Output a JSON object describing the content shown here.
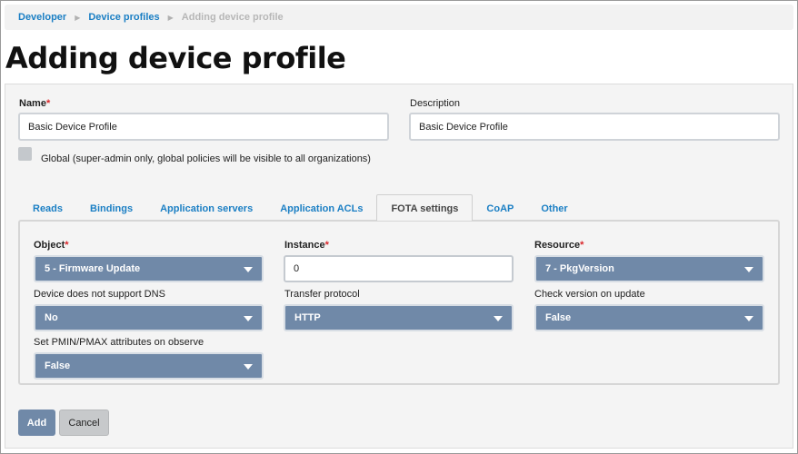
{
  "breadcrumb": {
    "items": [
      "Developer",
      "Device profiles"
    ],
    "current": "Adding device profile"
  },
  "page_title": "Adding device profile",
  "form": {
    "name_label": "Name",
    "name_required": "*",
    "name_value": "Basic Device Profile",
    "description_label": "Description",
    "description_value": "Basic Device Profile",
    "global_label": "Global (super-admin only, global policies will be visible to all organizations)",
    "global_checked": false
  },
  "tabs": [
    {
      "label": "Reads",
      "active": false
    },
    {
      "label": "Bindings",
      "active": false
    },
    {
      "label": "Application servers",
      "active": false
    },
    {
      "label": "Application ACLs",
      "active": false
    },
    {
      "label": "FOTA settings",
      "active": true
    },
    {
      "label": "CoAP",
      "active": false
    },
    {
      "label": "Other",
      "active": false
    }
  ],
  "fota": {
    "object_label": "Object",
    "object_value": "5 - Firmware Update",
    "instance_label": "Instance",
    "instance_value": "0",
    "resource_label": "Resource",
    "resource_value": "7 - PkgVersion",
    "dns_label": "Device does not support DNS",
    "dns_value": "No",
    "transfer_label": "Transfer protocol",
    "transfer_value": "HTTP",
    "check_label": "Check version on update",
    "check_value": "False",
    "pmin_label": "Set PMIN/PMAX attributes on observe",
    "pmin_value": "False",
    "required_mark": "*"
  },
  "actions": {
    "add_label": "Add",
    "cancel_label": "Cancel"
  },
  "colors": {
    "link": "#1b7fc4",
    "select_bg": "#7089a8",
    "required": "#d9262a",
    "panel_bg": "#f4f4f4"
  }
}
